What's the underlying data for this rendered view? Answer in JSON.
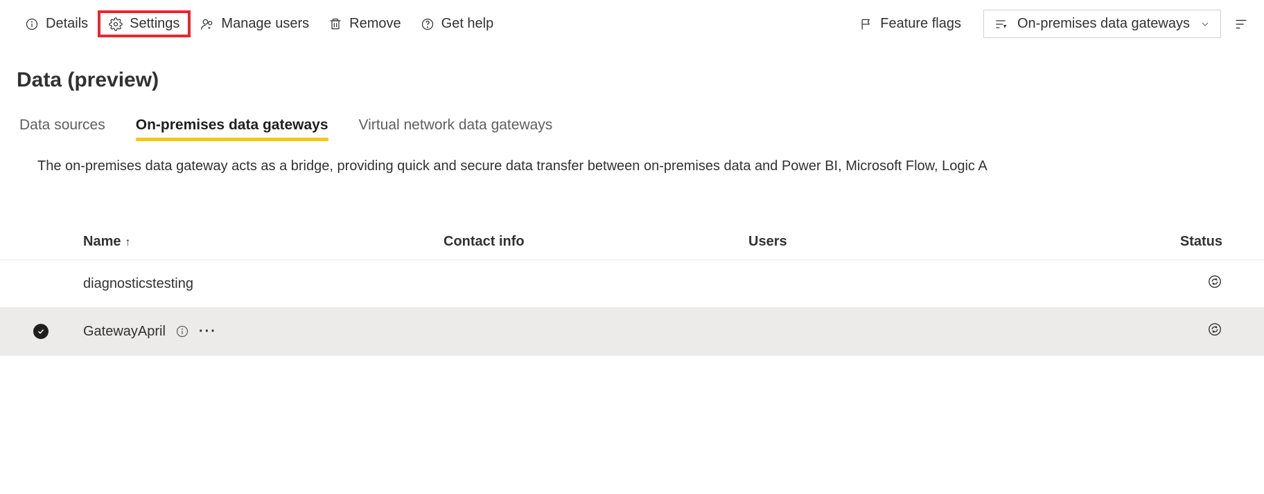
{
  "toolbar": {
    "details": "Details",
    "settings": "Settings",
    "manage_users": "Manage users",
    "remove": "Remove",
    "get_help": "Get help",
    "feature_flags": "Feature flags"
  },
  "view_dropdown": {
    "label": "On-premises data gateways"
  },
  "page": {
    "title": "Data (preview)",
    "description": "The on-premises data gateway acts as a bridge, providing quick and secure data transfer between on-premises data and Power BI, Microsoft Flow, Logic A"
  },
  "tabs": {
    "data_sources": "Data sources",
    "on_prem": "On-premises data gateways",
    "vnet": "Virtual network data gateways"
  },
  "table": {
    "headers": {
      "name": "Name",
      "contact": "Contact info",
      "users": "Users",
      "status": "Status"
    },
    "sort_indicator": "↑",
    "rows": [
      {
        "name": "diagnosticstesting",
        "selected": false,
        "info_icon": false
      },
      {
        "name": "GatewayApril",
        "selected": true,
        "info_icon": true
      }
    ]
  },
  "more_actions": "···"
}
